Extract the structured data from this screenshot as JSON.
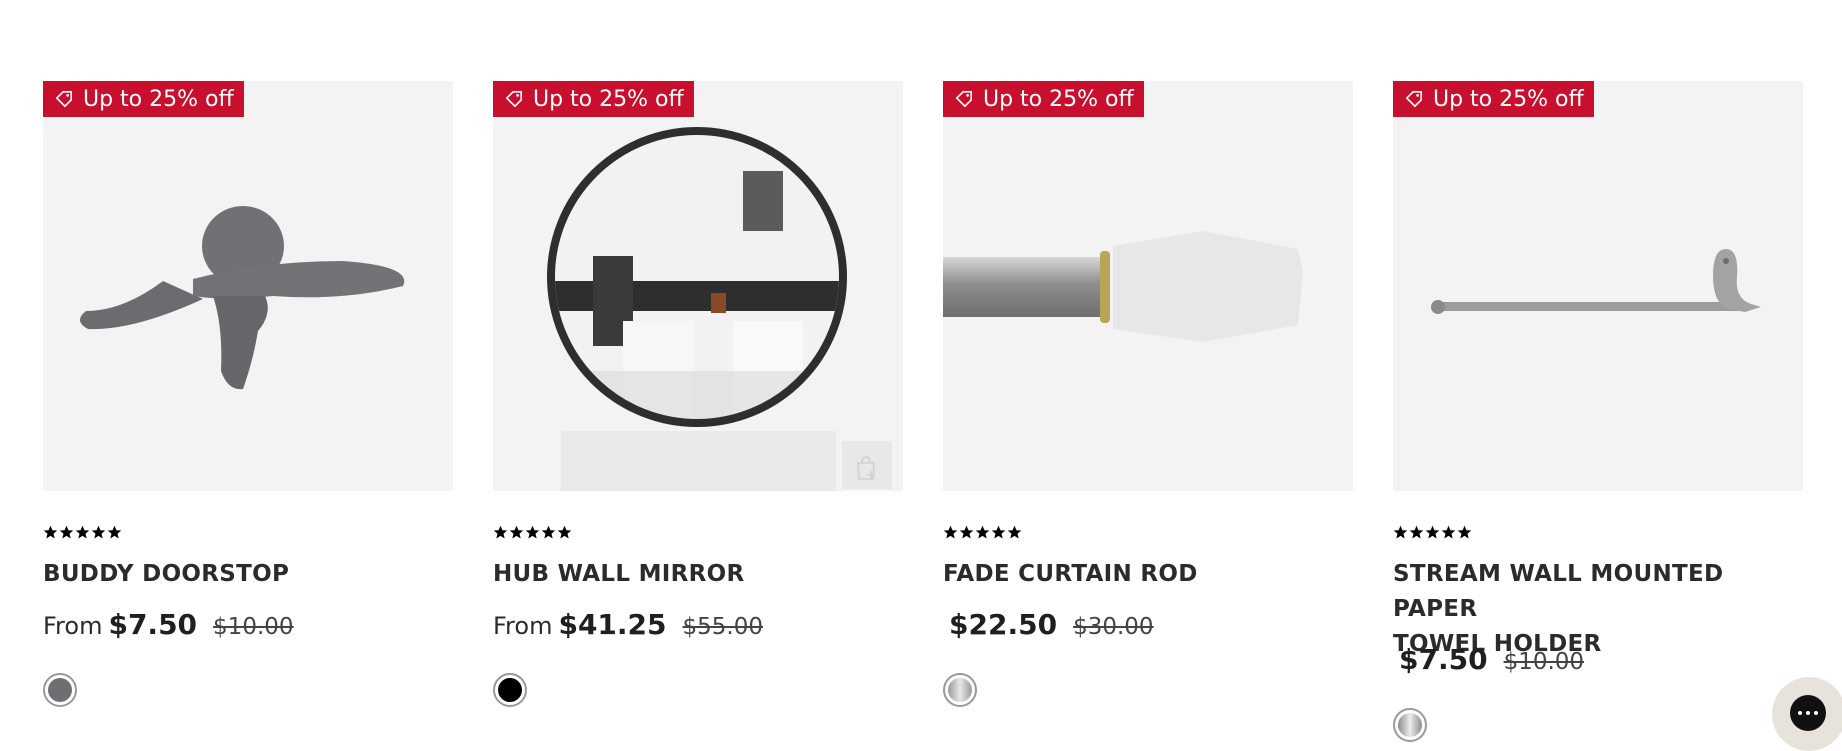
{
  "products": [
    {
      "badge": "Up to 25% off",
      "name": "BUDDY DOORSTOP",
      "name_line2": "",
      "from": "From",
      "price": "$7.50",
      "original_price": "$10.00",
      "rating": 4.8,
      "image": "doorstop-figure",
      "swatch_color": "#6d6f73"
    },
    {
      "badge": "Up to 25% off",
      "name": "HUB WALL MIRROR",
      "name_line2": "",
      "from": "From",
      "price": "$41.25",
      "original_price": "$55.00",
      "rating": 4.6,
      "image": "round-mirror",
      "swatch_color": "#000000"
    },
    {
      "badge": "Up to 25% off",
      "name": "FADE CURTAIN ROD",
      "name_line2": "",
      "from": "",
      "price": "$22.50",
      "original_price": "$30.00",
      "rating": 5,
      "image": "curtain-rod-finial",
      "swatch_color": "#c0c0c0"
    },
    {
      "badge": "Up to 25% off",
      "name": "STREAM WALL MOUNTED PAPER",
      "name_line2": "TOWEL HOLDER",
      "from": "",
      "price": "$7.50",
      "original_price": "$10.00",
      "rating": 4.9,
      "image": "towel-holder-bar",
      "swatch_color": "#b5b5b5"
    }
  ],
  "icons": {
    "badge": "tag-icon",
    "quick_add": "bag-plus-icon",
    "chat": "chat-icon"
  },
  "colors": {
    "badge_bg": "#c8102e",
    "image_bg": "#f3f3f3"
  }
}
